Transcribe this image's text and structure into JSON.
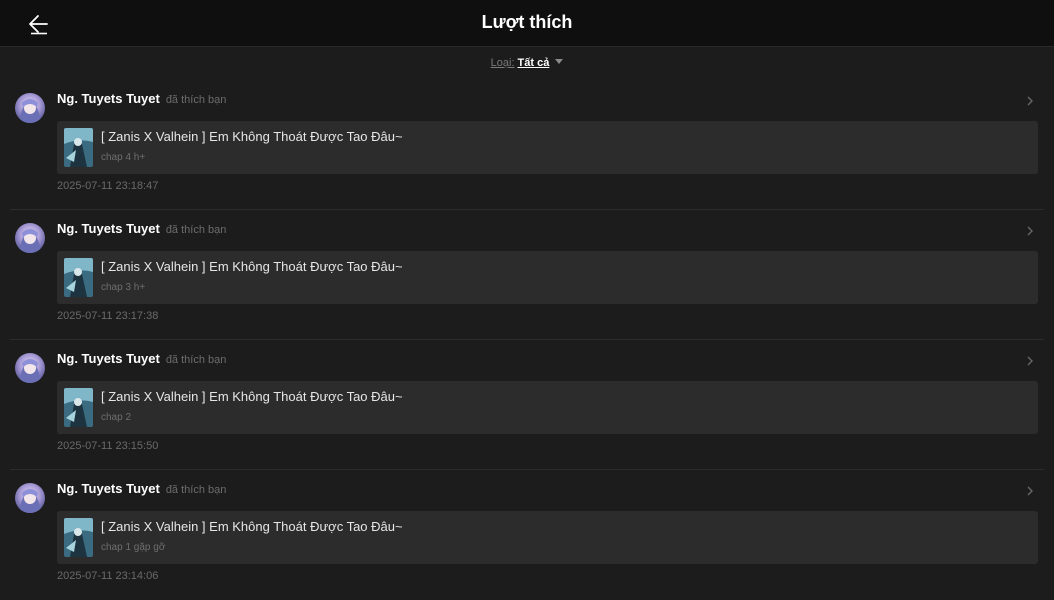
{
  "header": {
    "title": "Lượt thích",
    "back_icon": "arrow-left-icon"
  },
  "filter": {
    "label": "Loại:",
    "value": "Tất cả"
  },
  "likes": [
    {
      "user_name": "Ng. Tuyets Tuyet",
      "action": "đã thích bạn",
      "story_title": "[ Zanis X Valhein ] Em Không Thoát Được Tao Đâu~",
      "chapter": "chap 4 h+",
      "timestamp": "2025-07-11 23:18:47"
    },
    {
      "user_name": "Ng. Tuyets Tuyet",
      "action": "đã thích bạn",
      "story_title": "[ Zanis X Valhein ] Em Không Thoát Được Tao Đâu~",
      "chapter": "chap 3 h+",
      "timestamp": "2025-07-11 23:17:38"
    },
    {
      "user_name": "Ng. Tuyets Tuyet",
      "action": "đã thích bạn",
      "story_title": "[ Zanis X Valhein ] Em Không Thoát Được Tao Đâu~",
      "chapter": "chap 2",
      "timestamp": "2025-07-11 23:15:50"
    },
    {
      "user_name": "Ng. Tuyets Tuyet",
      "action": "đã thích bạn",
      "story_title": "[ Zanis X Valhein ] Em Không Thoát Được Tao Đâu~",
      "chapter": "chap 1 gặp gỡ",
      "timestamp": "2025-07-11 23:14:06"
    }
  ],
  "colors": {
    "background": "#1c1c1c",
    "header_bg": "#0f0f0f",
    "card_bg": "#2c2c2c",
    "muted_text": "#6c6c6c"
  }
}
